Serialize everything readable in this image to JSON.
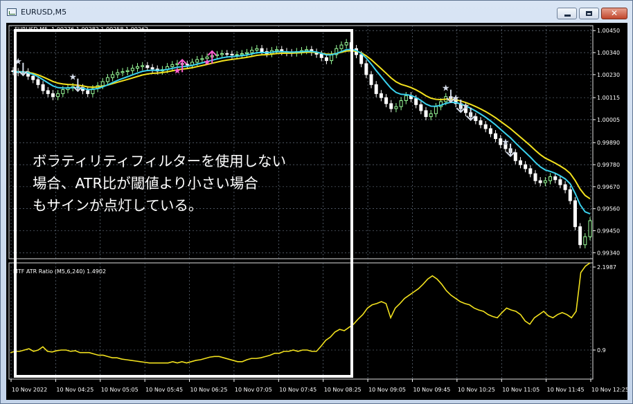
{
  "window": {
    "title": "EURUSD,M5",
    "colors": {
      "frame": "#c4d4ea",
      "chart_bg": "#000000",
      "close_button": "#c1462c"
    }
  },
  "legend": {
    "main": "EURUSD,M5  1.00276 1.00282 1.00258 1.00262",
    "indicator": "MTF ATR Ratio (M5,6,240) 1.4902"
  },
  "annotation_text": "ボラティリティフィルターを使用しない\n場合、ATR比が閾値より小さい場合\nもサインが点灯している。",
  "price_axis": {
    "ticks": [
      "1.00450",
      "1.00340",
      "1.00230",
      "1.00115",
      "1.00005",
      "0.99890",
      "0.99780",
      "0.99670",
      "0.99560",
      "0.99450",
      "0.99340"
    ]
  },
  "indicator_axis": {
    "ticks": [
      "2.1987",
      "0.9"
    ]
  },
  "time_axis": {
    "ticks": [
      "10 Nov 2022",
      "10 Nov 04:25",
      "10 Nov 05:05",
      "10 Nov 05:45",
      "10 Nov 06:25",
      "10 Nov 07:05",
      "10 Nov 07:45",
      "10 Nov 08:25",
      "10 Nov 09:05",
      "10 Nov 09:45",
      "10 Nov 10:25",
      "10 Nov 11:05",
      "10 Nov 11:45",
      "10 Nov 12:25"
    ]
  },
  "chart_data": {
    "type": "line",
    "symbol": "EURUSD",
    "timeframe": "M5",
    "price": {
      "ylim": [
        0.9931,
        1.00475
      ],
      "closes": [
        1.00245,
        1.0024,
        1.00244,
        1.00222,
        1.00205,
        1.0018,
        1.0015,
        1.00135,
        1.0012,
        1.00135,
        1.00155,
        1.00165,
        1.0017,
        1.00165,
        1.0015,
        1.00135,
        1.0016,
        1.00175,
        1.00195,
        1.00215,
        1.0023,
        1.0024,
        1.00245,
        1.0025,
        1.00262,
        1.0027,
        1.00275,
        1.00265,
        1.00258,
        1.00248,
        1.00255,
        1.0027,
        1.0028,
        1.00285,
        1.00282,
        1.00278,
        1.00292,
        1.00305,
        1.0031,
        1.00318,
        1.00325,
        1.0033,
        1.00335,
        1.00332,
        1.00328,
        1.0033,
        1.00335,
        1.0034,
        1.00352,
        1.0036,
        1.00345,
        1.00335,
        1.0035,
        1.00355,
        1.00345,
        1.0034,
        1.00338,
        1.00345,
        1.0035,
        1.00355,
        1.00342,
        1.00332,
        1.00315,
        1.003,
        1.0033,
        1.0036,
        1.00378,
        1.0039,
        1.0036,
        1.0033,
        1.00285,
        1.0023,
        1.0018,
        1.00135,
        1.00115,
        1.00085,
        1.0006,
        1.0007,
        1.001,
        1.00125,
        1.0011,
        1.0008,
        1.0005,
        1.0002,
        1.00035,
        1.0007,
        1.00095,
        1.0012,
        1.0011,
        1.00085,
        1.0006,
        1.0004,
        1.0002,
        1.0,
        0.9998,
        0.9996,
        0.99935,
        0.9991,
        0.9988,
        0.9986,
        0.9984,
        0.998,
        0.9978,
        0.9976,
        0.99735,
        0.997,
        0.9969,
        0.997,
        0.9972,
        0.99705,
        0.9968,
        0.99655,
        0.996,
        0.9947,
        0.9938,
        0.9942,
        0.995
      ],
      "ema_fast_final": 0.9963,
      "ema_slow_final": 0.997
    },
    "signals": [
      {
        "time_index": 2,
        "type": "sell"
      },
      {
        "time_index": 13,
        "type": "sell"
      },
      {
        "time_index": 34,
        "type": "buy"
      },
      {
        "time_index": 40,
        "type": "buy"
      },
      {
        "time_index": 88,
        "type": "sell"
      },
      {
        "time_index": 90,
        "type": "sell"
      },
      {
        "time_index": 92,
        "type": "sell"
      },
      {
        "time_index": 100,
        "type": "sell"
      }
    ],
    "indicator": {
      "name": "MTF ATR Ratio (M5,6,240)",
      "last_value": 1.4902,
      "threshold": 0.9,
      "ylim": [
        0.45,
        2.25
      ],
      "values": [
        0.86,
        0.88,
        0.88,
        0.9,
        0.92,
        0.88,
        0.9,
        0.95,
        0.88,
        0.87,
        0.89,
        0.9,
        0.9,
        0.88,
        0.89,
        0.86,
        0.86,
        0.86,
        0.84,
        0.82,
        0.82,
        0.8,
        0.78,
        0.78,
        0.76,
        0.75,
        0.74,
        0.73,
        0.72,
        0.71,
        0.7,
        0.7,
        0.7,
        0.7,
        0.7,
        0.72,
        0.7,
        0.72,
        0.7,
        0.72,
        0.74,
        0.75,
        0.77,
        0.79,
        0.8,
        0.8,
        0.78,
        0.76,
        0.74,
        0.72,
        0.72,
        0.75,
        0.77,
        0.77,
        0.78,
        0.8,
        0.82,
        0.85,
        0.85,
        0.88,
        0.88,
        0.9,
        0.88,
        0.9,
        0.9,
        0.88,
        0.88,
        0.96,
        1.05,
        1.1,
        1.18,
        1.22,
        1.2,
        1.25,
        1.3,
        1.38,
        1.45,
        1.55,
        1.6,
        1.62,
        1.65,
        1.62,
        1.4,
        1.55,
        1.62,
        1.7,
        1.75,
        1.8,
        1.85,
        1.92,
        2.0,
        2.05,
        2.0,
        1.92,
        1.82,
        1.75,
        1.7,
        1.65,
        1.62,
        1.6,
        1.55,
        1.52,
        1.5,
        1.45,
        1.42,
        1.4,
        1.48,
        1.55,
        1.52,
        1.5,
        1.45,
        1.35,
        1.3,
        1.4,
        1.45,
        1.5,
        1.43,
        1.4,
        1.45,
        1.48,
        1.45,
        1.4,
        1.5,
        2.1,
        2.2,
        2.25
      ]
    },
    "series_colors": {
      "fast_ma": "#3ad2ee",
      "slow_ma": "#f3e21e",
      "bull_candle": "#9bff9b",
      "bear_candle": "#ffffff",
      "indicator": "#f3e21e",
      "sell_signal": "#d4dbe8",
      "buy_signal": "#ff5fd2"
    }
  }
}
